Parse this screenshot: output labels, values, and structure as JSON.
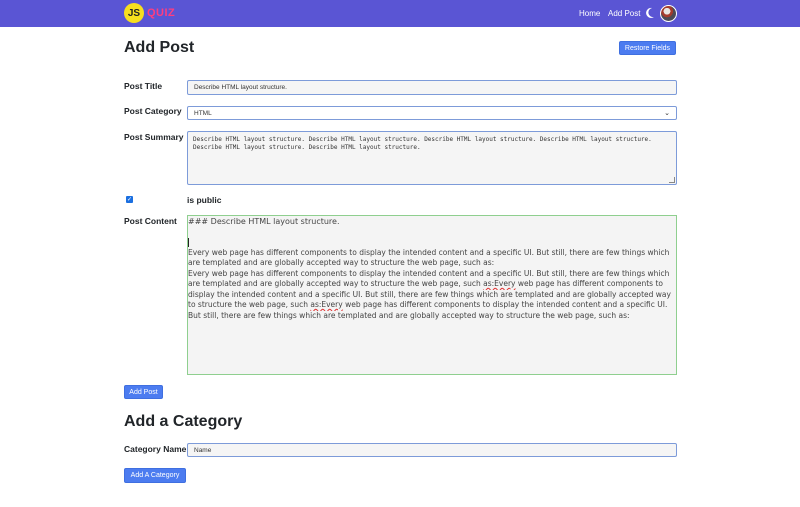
{
  "navbar": {
    "logo_badge": "JS",
    "logo_text": "QUIZ",
    "links": [
      "Home",
      "Add Post"
    ],
    "theme_icon": "moon-icon",
    "avatar_icon": "user-avatar"
  },
  "add_post": {
    "title": "Add Post",
    "restore_button": "Restore Fields",
    "post_title_label": "Post Title",
    "post_title_value": "Describe HTML layout structure.",
    "post_category_label": "Post Category",
    "post_category_value": "HTML",
    "post_summary_label": "Post Summary",
    "post_summary_value": "Describe HTML layout structure. Describe HTML layout structure. Describe HTML layout structure. Describe HTML layout structure. Describe HTML layout structure. Describe HTML layout structure.",
    "is_public_label": "is public",
    "is_public_checked": true,
    "post_content_label": "Post Content",
    "content": {
      "line1": "### Describe HTML layout structure.",
      "p1_l1": "Every web page has different components to display the intended content and a specific UI. But still, there are few things which",
      "p1_l2": "are templated and are globally accepted way to structure the web page, such as:",
      "p2_l1": "Every web page has different components to display the intended content and a specific UI. But still, there are few things which",
      "p2_l2a": "are templated and are globally accepted way to structure the web page, such ",
      "p2_l2b": "as:Every",
      "p2_l2c": " web page has different components to",
      "p2_l3": "display the intended content and a specific UI. But still, there are few things which are templated and are globally accepted way",
      "p2_l4a": "to structure the web page, such ",
      "p2_l4b": "as:Every",
      "p2_l4c": " web page has different components to display the intended content and a specific UI.",
      "p2_l5": "But still, there are few things which are templated and are globally accepted way to structure the web page, such as:"
    },
    "submit_button": "Add Post"
  },
  "add_category": {
    "title": "Add a Category",
    "name_label": "Category Name",
    "name_placeholder": "Name",
    "submit_button": "Add A Category"
  },
  "colors": {
    "navbar": "#5a55d4",
    "primary_button": "#4c7cf0",
    "logo_badge": "#f7df1e",
    "logo_text": "#ff3d7f",
    "editor_border": "#8fcf8f"
  }
}
